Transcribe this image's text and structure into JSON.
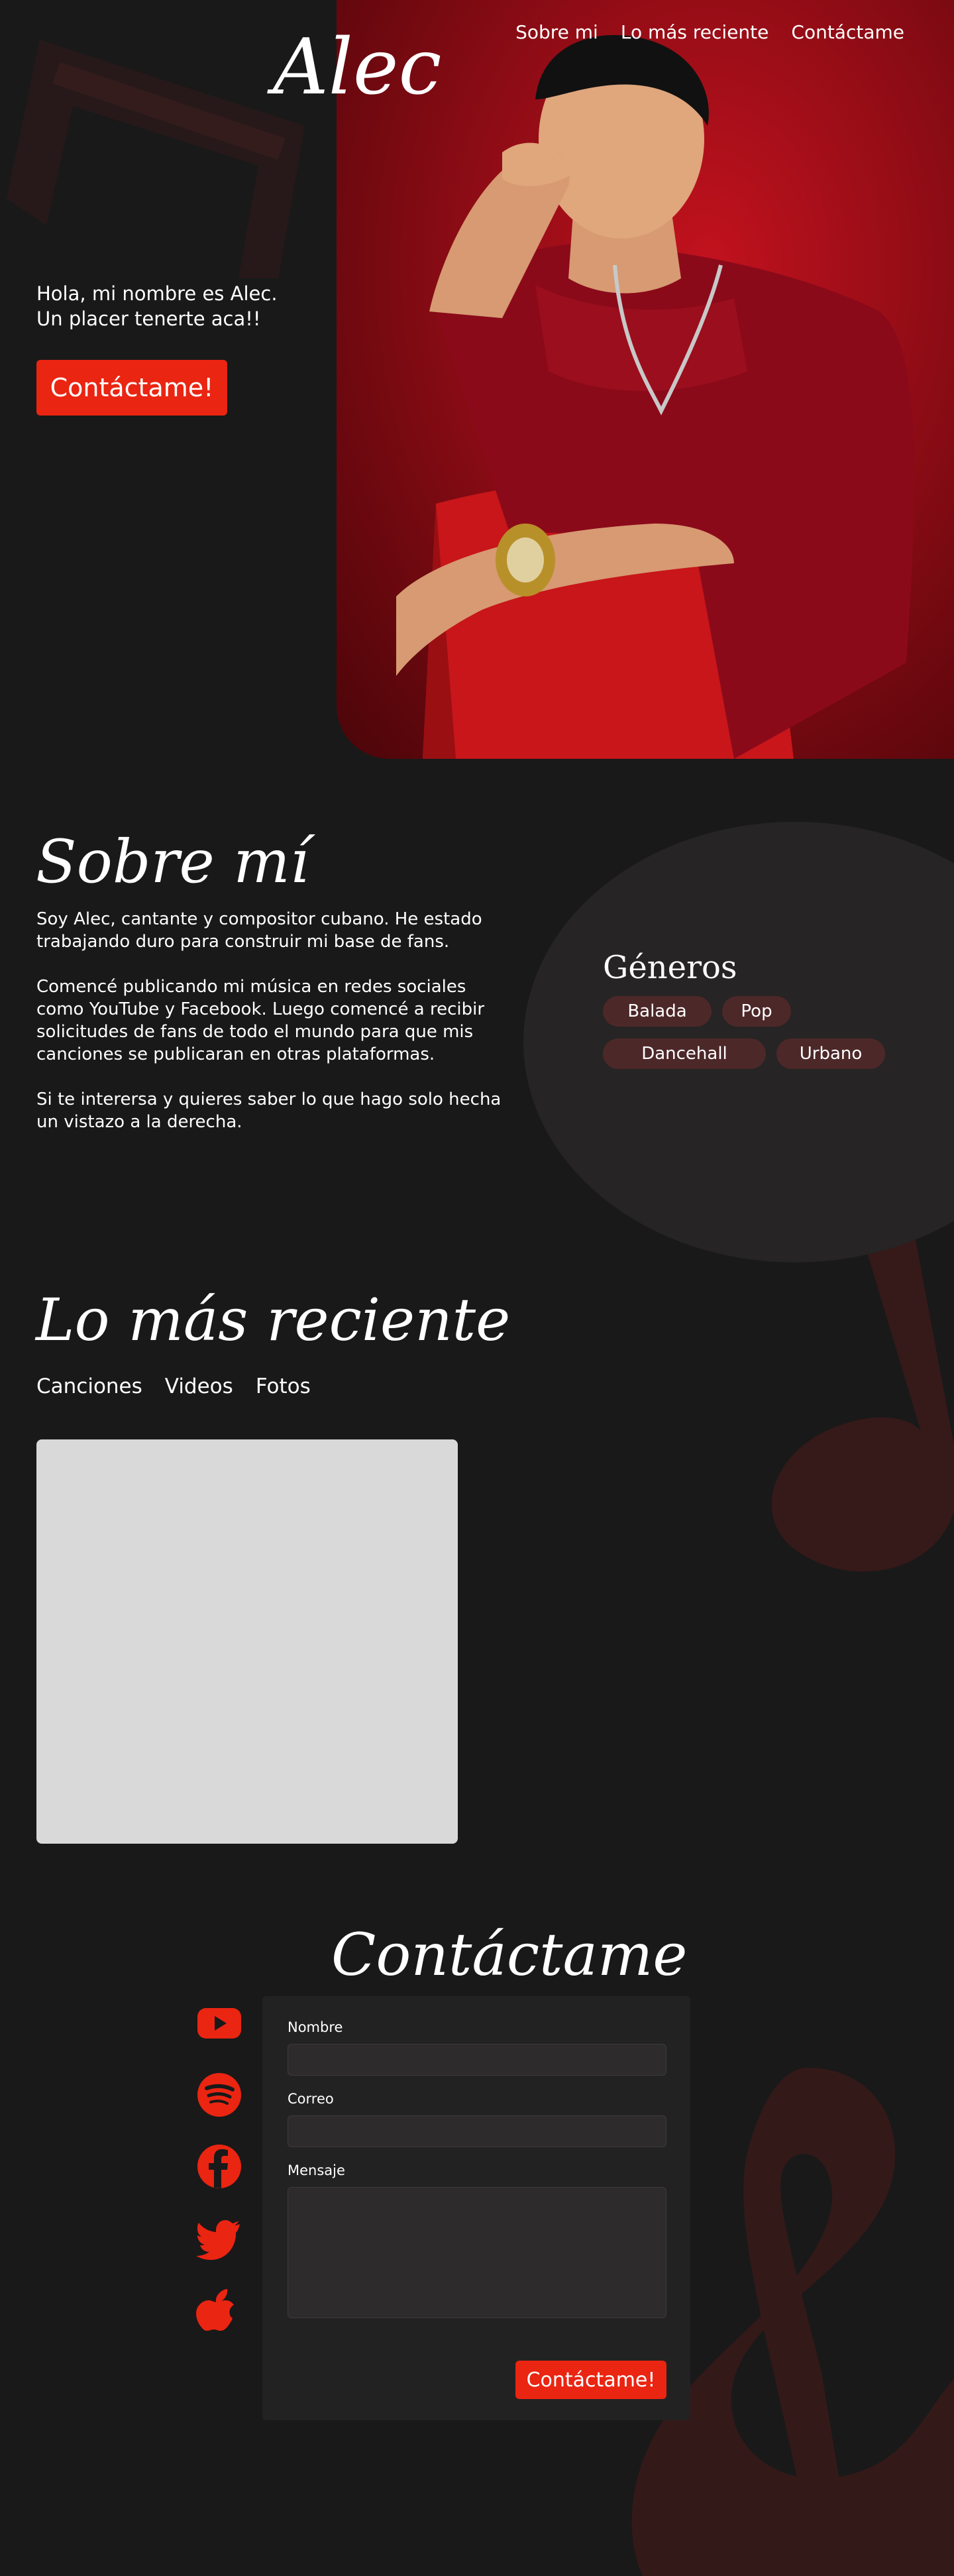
{
  "header": {
    "logo": "Alec",
    "nav": [
      "Sobre mi",
      "Lo más reciente",
      "Contáctame"
    ]
  },
  "hero": {
    "greeting_line1": "Hola, mi nombre es Alec.",
    "greeting_line2": "Un placer tenerte aca!!",
    "cta_label": "Contáctame!"
  },
  "about": {
    "title": "Sobre mí",
    "paragraphs": [
      "Soy Alec, cantante y compositor cubano. He estado trabajando duro para construir mi base de fans.",
      "Comencé publicando mi música en redes sociales como YouTube y Facebook. Luego comencé a recibir solicitudes de fans de todo el mundo para que mis canciones se publicaran en otras plataformas.",
      "Si te interersa y quieres saber lo que hago solo hecha un vistazo a la derecha."
    ],
    "genres_title": "Géneros",
    "genres": [
      "Balada",
      "Pop",
      "Dancehall",
      "Urbano"
    ]
  },
  "recent": {
    "title": "Lo más reciente",
    "tabs": [
      "Canciones",
      "Videos",
      "Fotos"
    ]
  },
  "contact": {
    "title": "Contáctame",
    "socials": [
      "youtube-icon",
      "spotify-icon",
      "facebook-icon",
      "twitter-icon",
      "apple-icon"
    ],
    "form": {
      "name_label": "Nombre",
      "email_label": "Correo",
      "message_label": "Mensaje",
      "submit_label": "Contáctame!"
    }
  },
  "colors": {
    "background": "#191919",
    "accent": "#ea2512",
    "pill": "#4d2829",
    "deco": "#3a1a1a"
  }
}
